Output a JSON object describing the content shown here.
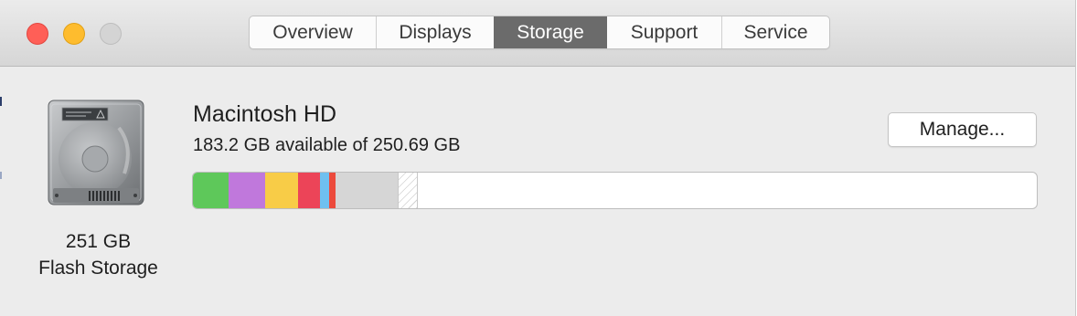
{
  "window": {
    "tabs": [
      {
        "label": "Overview",
        "active": false
      },
      {
        "label": "Displays",
        "active": false
      },
      {
        "label": "Storage",
        "active": true
      },
      {
        "label": "Support",
        "active": false
      },
      {
        "label": "Service",
        "active": false
      }
    ]
  },
  "drive": {
    "icon": "hard-drive-icon",
    "capacity": "251 GB",
    "type": "Flash Storage"
  },
  "volume": {
    "name": "Macintosh HD",
    "available_text": "183.2 GB available of 250.69 GB",
    "manage_label": "Manage..."
  },
  "storage_bar": {
    "segments": [
      {
        "color": "#5ec85a",
        "fraction": 0.042
      },
      {
        "color": "#c078dc",
        "fraction": 0.044
      },
      {
        "color": "#f8cc47",
        "fraction": 0.039
      },
      {
        "color": "#ec4458",
        "fraction": 0.026
      },
      {
        "color": "#6ec0f0",
        "fraction": 0.01
      },
      {
        "color": "#ec4a3c",
        "fraction": 0.008
      },
      {
        "color": "#d6d6d6",
        "fraction": 0.074
      },
      {
        "color": "hatch",
        "fraction": 0.024
      }
    ]
  }
}
